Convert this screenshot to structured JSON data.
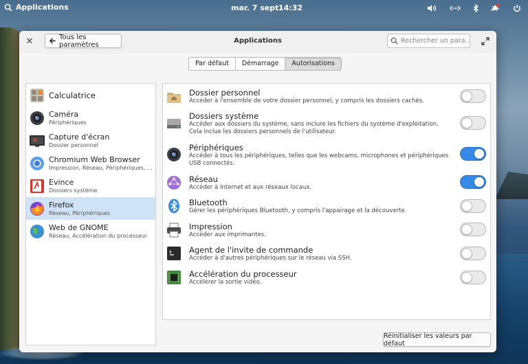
{
  "panel": {
    "applications_label": "Applications",
    "date": "mar. 7 sept.",
    "time": "14:32",
    "indicators": [
      "volume-icon",
      "network-icon",
      "bluetooth-icon",
      "notifications-icon",
      "power-icon"
    ]
  },
  "window": {
    "title": "Applications",
    "back_label": "Tous les paramètres",
    "search_placeholder": "Rechercher un para..."
  },
  "tabs": [
    {
      "label": "Par défaut",
      "active": false
    },
    {
      "label": "Démarrage",
      "active": false
    },
    {
      "label": "Autorisations",
      "active": true
    }
  ],
  "apps": [
    {
      "name": "Calculatrice",
      "subtitle": "",
      "icon": "calculator-icon"
    },
    {
      "name": "Caméra",
      "subtitle": "Périphériques",
      "icon": "camera-icon"
    },
    {
      "name": "Capture d'écran",
      "subtitle": "Dossier personnel",
      "icon": "screenshot-icon"
    },
    {
      "name": "Chromium Web Browser",
      "subtitle": "Impression, Réseau, Périphériques, Doss...",
      "icon": "chromium-icon"
    },
    {
      "name": "Evince",
      "subtitle": "Dossiers système",
      "icon": "evince-icon"
    },
    {
      "name": "Firefox",
      "subtitle": "Réseau, Périphériques",
      "icon": "firefox-icon",
      "selected": true
    },
    {
      "name": "Web de GNOME",
      "subtitle": "Réseau, Accélération du processeur",
      "icon": "gnome-web-icon"
    }
  ],
  "permissions": [
    {
      "title": "Dossier personnel",
      "desc": "Accéder à l'ensemble de votre dossier personnel, y compris les dossiers cachés.",
      "enabled": false,
      "icon": "home-folder-icon"
    },
    {
      "title": "Dossiers système",
      "desc": "Accéder aux dossiers du système, sans inclure les fichiers du système d'exploitation. Cela inclue les dossiers personnels de l'utilisateur.",
      "enabled": false,
      "icon": "drive-icon"
    },
    {
      "title": "Périphériques",
      "desc": "Accéder à tous les périphériques, telles que les webcams, microphones et périphériques USB connectés.",
      "enabled": true,
      "icon": "webcam-icon"
    },
    {
      "title": "Réseau",
      "desc": "Accéder à Internet et aux réseaux locaux.",
      "enabled": true,
      "icon": "network-globe-icon"
    },
    {
      "title": "Bluetooth",
      "desc": "Gérer les périphériques Bluetooth, y compris l'appairage et la découverte.",
      "enabled": false,
      "icon": "bluetooth-icon"
    },
    {
      "title": "Impression",
      "desc": "Accéder aux imprimantes.",
      "enabled": false,
      "icon": "printer-icon"
    },
    {
      "title": "Agent de l'invite de commande",
      "desc": "Accéder à d'autres périphériques sur le réseau via SSH.",
      "enabled": false,
      "icon": "terminal-icon"
    },
    {
      "title": "Accélération du processeur",
      "desc": "Accélérer la sortie vidéo.",
      "enabled": false,
      "icon": "gpu-chip-icon"
    }
  ],
  "reset_label": "Réinitialiser les valeurs par défaut",
  "colors": {
    "accent": "#3689e6",
    "selection": "#cfe2f6"
  }
}
